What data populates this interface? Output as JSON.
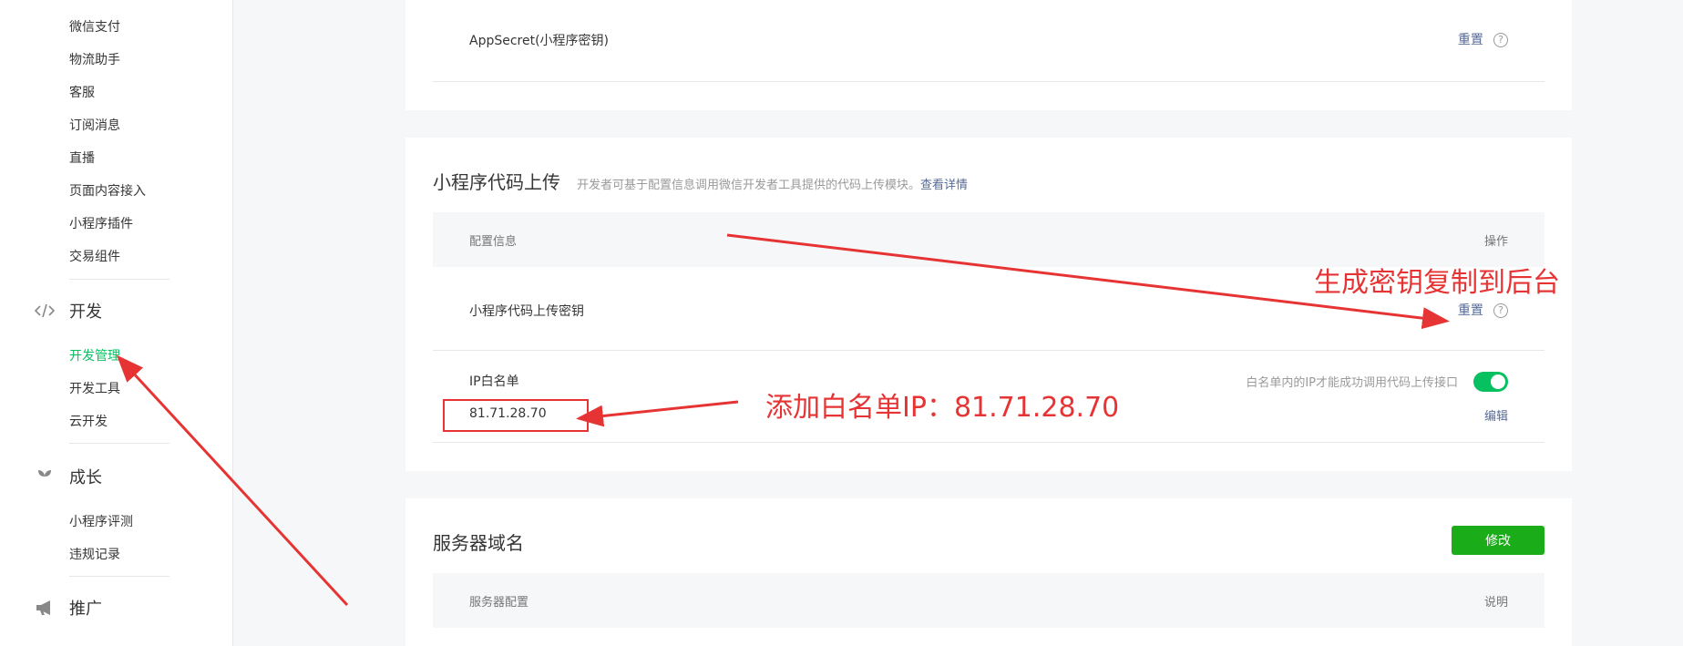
{
  "sidebar": {
    "items_top": [
      "微信支付",
      "物流助手",
      "客服",
      "订阅消息",
      "直播",
      "页面内容接入",
      "小程序插件",
      "交易组件"
    ],
    "group_dev": {
      "label": "开发",
      "icon": "code-icon"
    },
    "items_dev": [
      "开发管理",
      "开发工具",
      "云开发"
    ],
    "active_item": "开发管理",
    "group_growth": {
      "label": "成长",
      "icon": "sprout-icon"
    },
    "items_growth": [
      "小程序评测",
      "违规记录"
    ],
    "group_promo": {
      "label": "推广",
      "icon": "megaphone-icon"
    }
  },
  "appsecret_card": {
    "label": "AppSecret(小程序密钥)",
    "reset_label": "重置",
    "help_symbol": "?"
  },
  "upload_card": {
    "title": "小程序代码上传",
    "desc": "开发者可基于配置信息调用微信开发者工具提供的代码上传模块。",
    "detail_link": "查看详情",
    "header_config": "配置信息",
    "header_action": "操作",
    "key_label": "小程序代码上传密钥",
    "key_reset": "重置",
    "help_symbol": "?",
    "ip_label": "IP白名单",
    "ip_value": "81.71.28.70",
    "toggle_text": "白名单内的IP才能成功调用代码上传接口",
    "toggle_on": true,
    "edit_label": "编辑"
  },
  "server_card": {
    "title": "服务器域名",
    "modify_button": "修改",
    "header_config": "服务器配置",
    "header_desc": "说明"
  },
  "annotations": {
    "copy_key": "生成密钥复制到后台",
    "add_ip": "添加白名单IP：81.71.28.70"
  },
  "colors": {
    "accent_green": "#07c160",
    "button_green": "#1aad19",
    "link_blue": "#576b95",
    "annotation_red": "#e63434"
  }
}
